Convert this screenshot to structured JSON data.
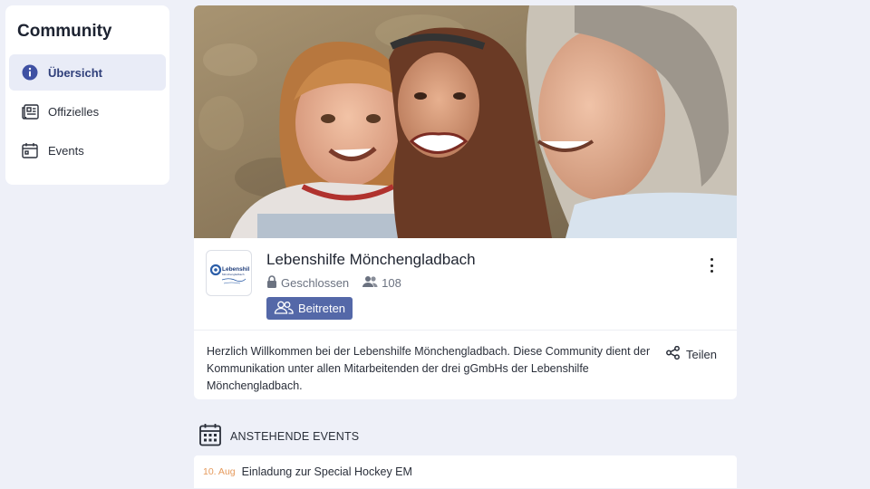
{
  "sidebar": {
    "title": "Community",
    "items": [
      {
        "label": "Übersicht",
        "icon": "info-icon",
        "active": true
      },
      {
        "label": "Offizielles",
        "icon": "newspaper-icon",
        "active": false
      },
      {
        "label": "Events",
        "icon": "calendar-icon",
        "active": false
      }
    ]
  },
  "community": {
    "name": "Lebenshilfe Mönchengladbach",
    "privacy": "Geschlossen",
    "members": "108",
    "join_label": "Beitreten",
    "description": "Herzlich Willkommen bei der Lebenshilfe Mönchengladbach. Diese Community dient der Kommunikation unter allen Mitarbeitenden der drei gGmbHs der Lebenshilfe Mönchengladbach.",
    "share_label": "Teilen",
    "logo_text": "Lebenshilfe"
  },
  "events": {
    "title": "ANSTEHENDE EVENTS",
    "items": [
      {
        "date": "10. Aug",
        "name": "Einladung zur Special Hockey EM"
      }
    ]
  },
  "colors": {
    "accent": "#5468a8",
    "page_bg": "#eef0f8",
    "event_date": "#e59a5c"
  }
}
